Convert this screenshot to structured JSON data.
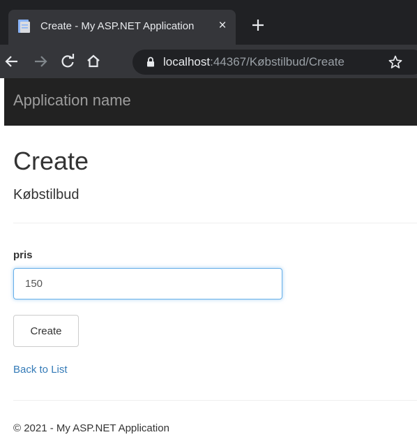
{
  "browser": {
    "tab_title": "Create - My ASP.NET Application",
    "tab_close": "×",
    "url_host": "localhost",
    "url_rest": ":44367/Købstilbud/Create"
  },
  "navbar": {
    "brand": "Application name"
  },
  "main": {
    "title": "Create",
    "subtitle": "Købstilbud",
    "form": {
      "label": "pris",
      "value": "150",
      "submit_label": "Create"
    },
    "back_link": "Back to List"
  },
  "footer": {
    "text": "© 2021 - My ASP.NET Application"
  },
  "colors": {
    "tabstrip": "#202124",
    "toolbar": "#35363a",
    "navbar": "#222222",
    "link": "#337ab7",
    "focus_border": "#66afe9"
  },
  "icons": {
    "favicon": "page-icon",
    "tab_close": "close-icon",
    "new_tab": "plus-icon",
    "back": "arrow-left-icon",
    "forward": "arrow-right-icon",
    "reload": "reload-icon",
    "home": "home-icon",
    "lock": "lock-icon",
    "bookmark": "star-icon"
  }
}
